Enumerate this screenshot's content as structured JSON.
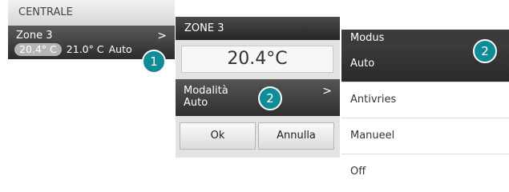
{
  "panel_centrale": {
    "title": "CENTRALE",
    "zone_name": "Zone 3",
    "measured_temp": "20.4° C",
    "set_temp": "21.0° C",
    "mode": "Auto",
    "chevron": ">"
  },
  "panel_zone": {
    "title": "ZONE 3",
    "temperature": "20.4°C",
    "mode_label": "Modalità",
    "mode_value": "Auto",
    "chevron": ">",
    "ok_label": "Ok",
    "cancel_label": "Annulla"
  },
  "panel_modus": {
    "title": "Modus",
    "options": [
      "Auto",
      "Antivries",
      "Manueel",
      "Off"
    ],
    "selected": "Auto"
  },
  "callouts": {
    "one": "1",
    "two": "2"
  },
  "colors": {
    "callout": "#0f8c96",
    "dark_row": "#2f2f2f"
  }
}
